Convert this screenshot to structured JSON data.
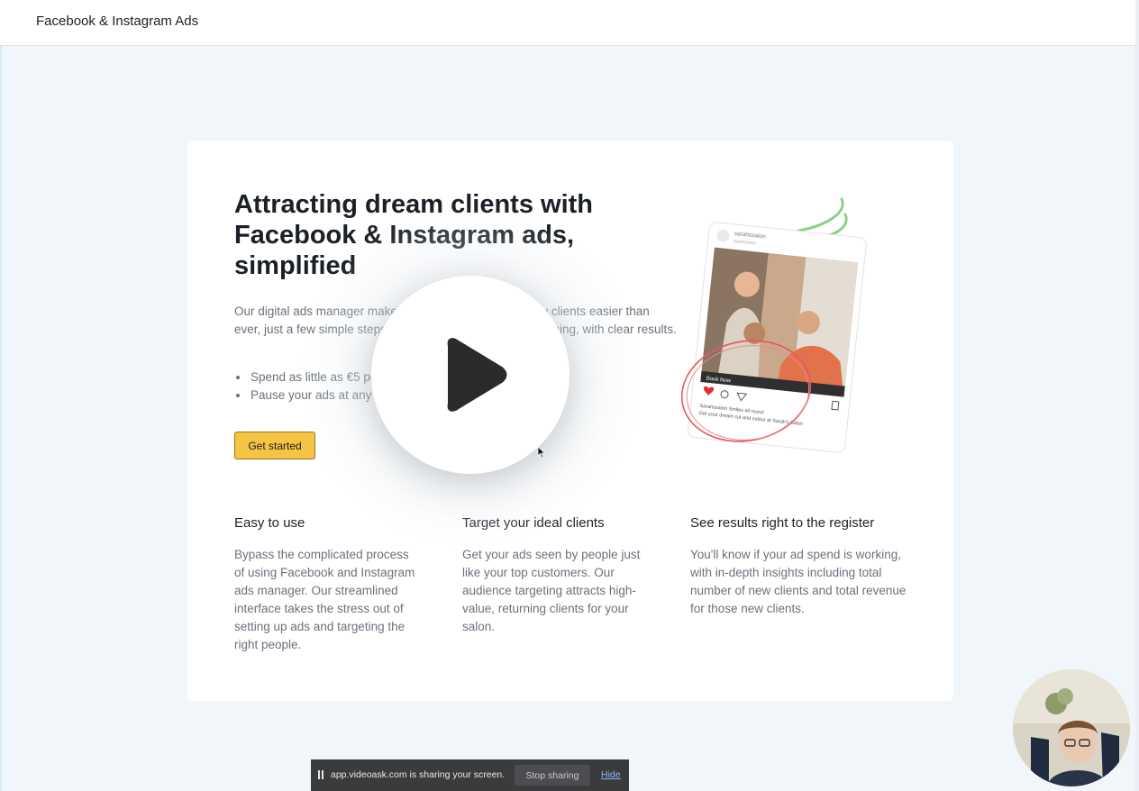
{
  "topbar": {
    "title": "Facebook & Instagram Ads"
  },
  "hero": {
    "headline": "Attracting dream clients with Facebook & Instagram ads, simplified",
    "description": "Our digital ads manager makes attracting high-quality new clients easier than ever, just a few simple steps and your ad will be up and running, with clear results.",
    "bullets": [
      "Spend as little as €5 per day",
      "Pause your ads at any time"
    ],
    "cta_label": "Get started"
  },
  "illustration": {
    "account_name": "sarahssalon",
    "sponsored_label": "Sponsored",
    "book_now_label": "Book Now",
    "caption_line1": "Sarahssalon Smiles all round",
    "caption_line2": "Get your dream cut and colour at Sarah's Salon"
  },
  "features": [
    {
      "title": "Easy to use",
      "body": "Bypass the complicated process of using Facebook and Instagram ads manager. Our streamlined interface takes the stress out of setting up ads and targeting the right people."
    },
    {
      "title": "Target your ideal clients",
      "body": "Get your ads seen by people just like your top customers. Our audience targeting attracts high-value, returning clients for your salon."
    },
    {
      "title": "See results right to the register",
      "body": "You'll know if your ad spend is working, with in-depth insights including total number of new clients and total revenue for those new clients."
    }
  ],
  "sharebar": {
    "message": "app.videoask.com is sharing your screen.",
    "stop_label": "Stop sharing",
    "hide_label": "Hide"
  },
  "icons": {
    "play": "play-icon",
    "pause": "pause-icon",
    "cursor": "cursor-icon"
  },
  "colors": {
    "cta": "#f6c444",
    "background": "#f1f6fb",
    "sharebar": "#3a3b3d"
  }
}
